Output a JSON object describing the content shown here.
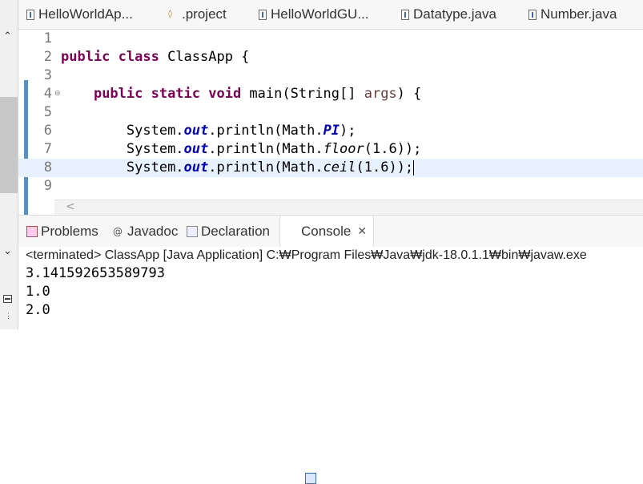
{
  "editor_tabs": [
    {
      "label": "HelloWorldAp...",
      "icon": "java-file-icon"
    },
    {
      "label": ".project",
      "icon": "project-file-icon"
    },
    {
      "label": "HelloWorldGU...",
      "icon": "java-file-icon"
    },
    {
      "label": "Datatype.java",
      "icon": "java-file-icon"
    },
    {
      "label": "Number.java",
      "icon": "java-file-icon"
    }
  ],
  "editor": {
    "line_numbers": [
      "1",
      "2",
      "3",
      "4",
      "5",
      "6",
      "7",
      "8",
      "9"
    ],
    "fold_marker": "⊖",
    "code": {
      "l2_kw": "public class",
      "l2_rest": " ClassApp {",
      "l4_kw": "public static void",
      "l4_mid": " main(String[] ",
      "l4_param": "args",
      "l4_end": ") {",
      "sys": "System.",
      "out": "out",
      "println_math": ".println(Math.",
      "l6_field": "PI",
      "l6_end": ");",
      "l7_method": "floor",
      "l7_end": "(1.6));",
      "l8_method": "ceil",
      "l8_end": "(1.6));"
    },
    "scroll_left": "<"
  },
  "view_tabs": [
    {
      "label": "Problems",
      "icon": "problems-icon"
    },
    {
      "label": "Javadoc",
      "icon": "javadoc-icon",
      "glyph": "@"
    },
    {
      "label": "Declaration",
      "icon": "declaration-icon"
    },
    {
      "label": "Console",
      "icon": "console-icon",
      "active": true,
      "close": "✕"
    }
  ],
  "console": {
    "status": "<terminated> ClassApp [Java Application] C:₩Program Files₩Java₩jdk-18.0.1.1₩bin₩javaw.exe",
    "output": [
      "3.141592653589793",
      "1.0",
      "2.0"
    ]
  },
  "left_trim": {
    "up": "⌃",
    "down": "⌄",
    "more": "⋮"
  }
}
